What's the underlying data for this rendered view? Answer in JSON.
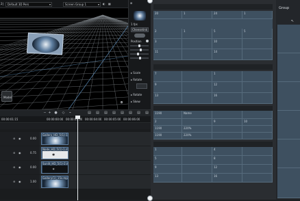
{
  "viewport": {
    "title_fragment": "2|",
    "camera_select": "Default 3D Pers",
    "group_select": "Screen Group 1",
    "corner_label": "Model"
  },
  "props": {
    "frame_label": "1 fps",
    "btn_label": "Cheeselink",
    "position_label": "Position",
    "row_labels": [
      "Scale",
      "Rotate",
      "Rotate",
      "Skew"
    ]
  },
  "timeline": {
    "ruler": [
      "00:00:01:15",
      "00:00:00:00",
      "00:00:03:00",
      "00:00:04:00",
      "00:00:05:00",
      "00:00:06:00"
    ],
    "tracks": [
      {
        "value": "0.00",
        "clip": "Gallery_HD_5(1)-1.mp4"
      },
      {
        "value": "0.75",
        "clip": "Node_HD_5(1)-1.mp4"
      },
      {
        "value": "0.00",
        "clip": "Sunlit_HD_5(1)-2.mp4"
      },
      {
        "value": "1.00",
        "clip": "Gallery(1)_15s.mp4"
      }
    ]
  },
  "right": {
    "group_title": "Group",
    "panel1": {
      "r0": [
        "20",
        "1",
        "24",
        "1"
      ],
      "r1": [
        "2",
        "1",
        "5",
        "5"
      ],
      "r2": [
        "3",
        "",
        "10",
        ""
      ],
      "r3": [
        "11",
        "",
        "14",
        ""
      ]
    },
    "panel2": {
      "r0": [
        "7",
        "",
        "1",
        ""
      ],
      "r1": [
        "9",
        "",
        "12",
        ""
      ],
      "r2": [
        "13",
        "",
        "16",
        ""
      ]
    },
    "panel3": {
      "r0": [
        "1190",
        "Name",
        "",
        ""
      ],
      "r1": [
        "2",
        "",
        "9",
        "",
        "10"
      ],
      "r2": [
        "1190",
        "220%",
        "",
        ""
      ],
      "r3": [
        "1190",
        "220%",
        "",
        ""
      ]
    },
    "panel4": {
      "r0": [
        "1",
        "",
        "4",
        ""
      ],
      "r1": [
        "5",
        "",
        "8",
        ""
      ],
      "r2": [
        "9",
        "",
        "12",
        ""
      ],
      "r3": [
        "13",
        "",
        "16",
        ""
      ]
    }
  }
}
